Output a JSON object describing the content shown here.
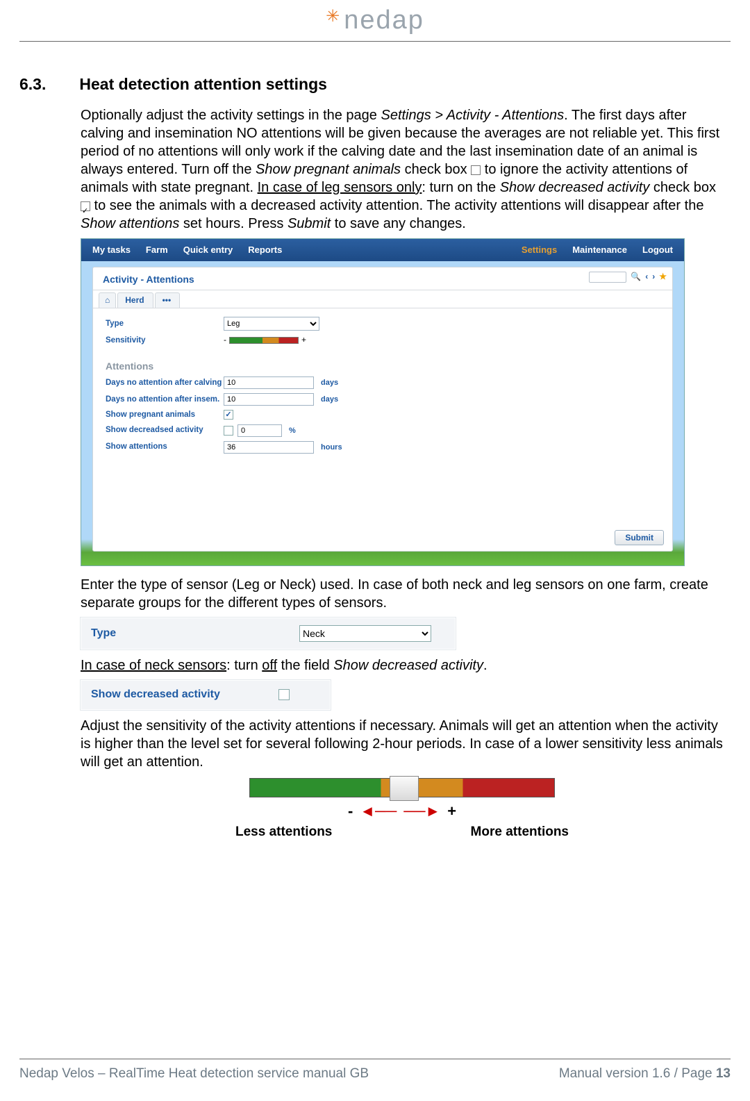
{
  "brand": {
    "name": "nedap"
  },
  "section": {
    "number": "6.3.",
    "title": "Heat detection attention settings"
  },
  "para1": {
    "t1": "Optionally adjust the activity settings in the page ",
    "path": "Settings > Activity - Attentions",
    "t2": ". The first days after calving and insemination NO attentions will be given because the averages are not reliable yet. This first period of no attentions will only work if the calving date and the last insemination date of an animal is always entered. Turn off the ",
    "spa": "Show pregnant animals",
    "t3": " check box ",
    "t4": " to ignore the activity attentions of animals with state pregnant. ",
    "leg": "In case of leg sensors only",
    "t5": ": turn on the ",
    "sda": "Show decreased activity",
    "t6": " check box ",
    "t7": " to see the animals with a decreased activity attention. The activity attentions will disappear after the ",
    "sa": "Show attentions",
    "t8": " set hours. Press ",
    "submit": "Submit",
    "t9": " to save any changes."
  },
  "app": {
    "menu": {
      "my_tasks": "My tasks",
      "farm": "Farm",
      "quick_entry": "Quick entry",
      "reports": "Reports",
      "settings": "Settings",
      "maintenance": "Maintenance",
      "logout": "Logout"
    },
    "card_title": "Activity - Attentions",
    "tabs": {
      "home": "⌂",
      "herd": "Herd",
      "more": "•••"
    },
    "tools": {
      "search_icon": "🔍",
      "prev": "‹",
      "next": "›",
      "star": "★"
    },
    "form": {
      "type_label": "Type",
      "type_value": "Leg",
      "sensitivity_label": "Sensitivity",
      "minus": "-",
      "plus": "+",
      "attentions_heading": "Attentions",
      "days_calving_label": "Days no attention after calving",
      "days_calving_value": "10",
      "days_unit": "days",
      "days_insem_label": "Days no attention after insem.",
      "days_insem_value": "10",
      "show_pregnant_label": "Show pregnant animals",
      "show_pregnant_checked": true,
      "show_decreased_label": "Show decreadsed activity",
      "show_decreased_checked": false,
      "show_decreased_value": "0",
      "pct_unit": "%",
      "show_attn_label": "Show attentions",
      "show_attn_value": "36",
      "hours_unit": "hours",
      "submit": "Submit"
    }
  },
  "para2": "Enter the type of sensor (Leg or Neck) used. In case of both neck and leg sensors on one farm, create separate groups for the different types of sensors.",
  "type_shot": {
    "label": "Type",
    "value": "Neck"
  },
  "neck_note": {
    "prefix": "In case of neck sensors",
    "mid1": ":  turn ",
    "off": "off",
    "mid2": " the field ",
    "field": "Show decreased activity",
    "tail": "."
  },
  "sda_shot": {
    "label": "Show decreased activity"
  },
  "para3": "Adjust the sensitivity of the activity attentions if necessary. Animals will get an attention when the activity is higher than the level set for several following 2-hour periods. In case of a lower sensitivity less animals will get an attention.",
  "slider": {
    "minus": "-",
    "plus": "+",
    "less": "Less attentions",
    "more": "More attentions"
  },
  "footer": {
    "left": "Nedap Velos – RealTime Heat detection service manual GB",
    "right_a": "Manual version 1.6 / Page ",
    "right_b": "13"
  }
}
